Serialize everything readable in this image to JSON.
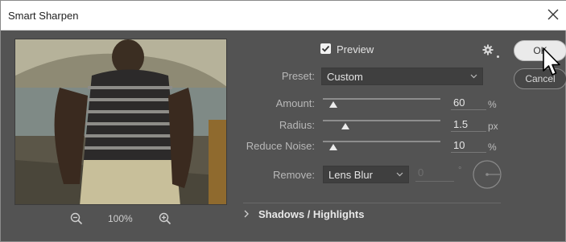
{
  "window": {
    "title": "Smart Sharpen"
  },
  "preview": {
    "label": "Preview",
    "checked": true,
    "zoom_level": "100%"
  },
  "preset": {
    "label": "Preset:",
    "value": "Custom"
  },
  "amount": {
    "label": "Amount:",
    "value": "60",
    "unit": "%",
    "slider_fraction": 0.09
  },
  "radius": {
    "label": "Radius:",
    "value": "1.5",
    "unit": "px",
    "slider_fraction": 0.19
  },
  "reduce_noise": {
    "label": "Reduce Noise:",
    "value": "10",
    "unit": "%",
    "slider_fraction": 0.09
  },
  "remove": {
    "label": "Remove:",
    "value": "Lens Blur",
    "angle_value": "0",
    "angle_unit": "°"
  },
  "buttons": {
    "ok": "OK",
    "cancel": "Cancel"
  },
  "section": {
    "label": "Shadows / Highlights"
  },
  "colors": {
    "panel": "#535353",
    "button_ok": "#eaeaea",
    "checkbox": "#f2f2f2"
  },
  "icons": [
    "close-icon",
    "gear-icon",
    "zoom-out-icon",
    "zoom-in-icon",
    "chevron-down-icon",
    "chevron-right-icon",
    "angle-dial-icon",
    "cursor-icon"
  ]
}
